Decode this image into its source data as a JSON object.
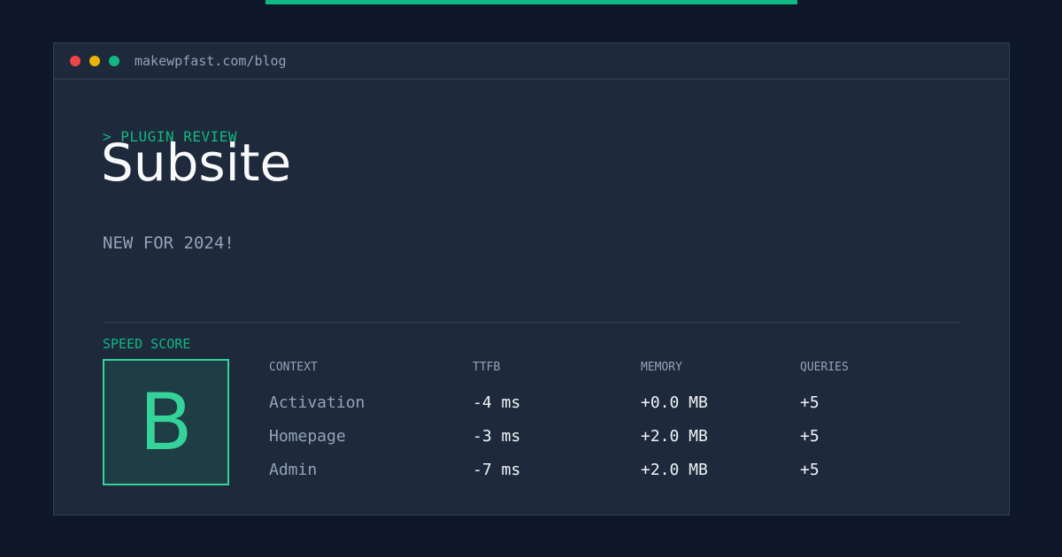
{
  "colors": {
    "background": "#0f172a",
    "card": "#1e293b",
    "accent": "#10b981",
    "grade_accent": "#34d399",
    "dot_red": "#ef4444",
    "dot_yellow": "#eab308",
    "dot_green": "#10b981"
  },
  "window": {
    "url": "makewpfast.com/blog",
    "dots": [
      "close-dot",
      "minimize-dot",
      "maximize-dot"
    ]
  },
  "post": {
    "eyebrow": "> PLUGIN REVIEW",
    "title": "Subsite",
    "subtitle": "NEW FOR 2024!"
  },
  "score": {
    "label": "SPEED SCORE",
    "grade": "B"
  },
  "table": {
    "headers": {
      "context": "CONTEXT",
      "ttfb": "TTFB",
      "memory": "MEMORY",
      "queries": "QUERIES"
    },
    "rows": [
      {
        "context": "Activation",
        "ttfb": "-4 ms",
        "memory": "+0.0 MB",
        "queries": "+5"
      },
      {
        "context": "Homepage",
        "ttfb": "-3 ms",
        "memory": "+2.0 MB",
        "queries": "+5"
      },
      {
        "context": "Admin",
        "ttfb": "-7 ms",
        "memory": "+2.0 MB",
        "queries": "+5"
      }
    ]
  }
}
